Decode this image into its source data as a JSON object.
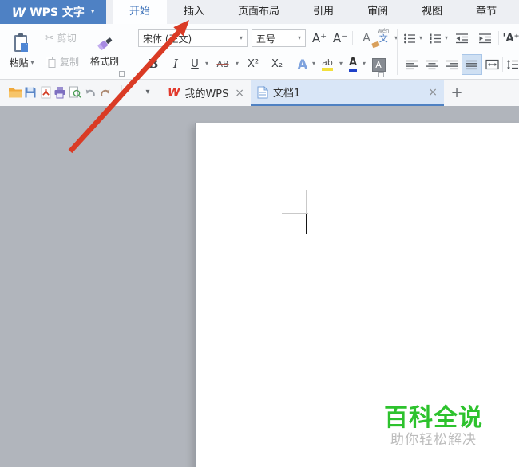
{
  "app": {
    "logo_letter": "W",
    "name": "WPS 文字"
  },
  "glyphs": {
    "dropdown": "▾",
    "close": "×",
    "new_tab": "+",
    "scissors": "✂"
  },
  "menu_tabs": {
    "items": [
      {
        "label": "开始",
        "active": true
      },
      {
        "label": "插入",
        "active": false
      },
      {
        "label": "页面布局",
        "active": false
      },
      {
        "label": "引用",
        "active": false
      },
      {
        "label": "审阅",
        "active": false
      },
      {
        "label": "视图",
        "active": false
      },
      {
        "label": "章节",
        "active": false
      }
    ]
  },
  "ribbon": {
    "paste": "粘贴",
    "cut": "剪切",
    "copy": "复制",
    "format_painter": "格式刷",
    "font_family": "宋体 (正文)",
    "font_size": "五号",
    "bold": "B",
    "italic": "I",
    "underline": "U",
    "strikethrough": "AB",
    "superscript": "X²",
    "subscript": "X₂",
    "grow_font": "A⁺",
    "shrink_font": "A⁻",
    "phonetic_top": "wén",
    "phonetic_bottom": "文",
    "text_effect": "A",
    "highlight": "ab",
    "font_color": "A",
    "char_shading": "A",
    "text_tool": "'A⁺"
  },
  "doc_tabs": {
    "items": [
      {
        "label": "我的WPS",
        "active": false
      },
      {
        "label": "文档1",
        "active": true
      }
    ]
  },
  "watermark": {
    "title": "百科全说",
    "subtitle": "助你轻松解决"
  },
  "annotation": {
    "arrow_points_to": "插入"
  },
  "colors": {
    "titlebar_blue": "#4e81c4",
    "active_tab_blue": "#3a70b9",
    "arrow_red": "#da3b25",
    "doc_tab_active": "#d9e6f7",
    "canvas_gray": "#b1b5bc",
    "watermark_green": "#2dc22d",
    "watermark_gray": "#bcbcbc",
    "format_painter_purple": "#a78ae2"
  }
}
